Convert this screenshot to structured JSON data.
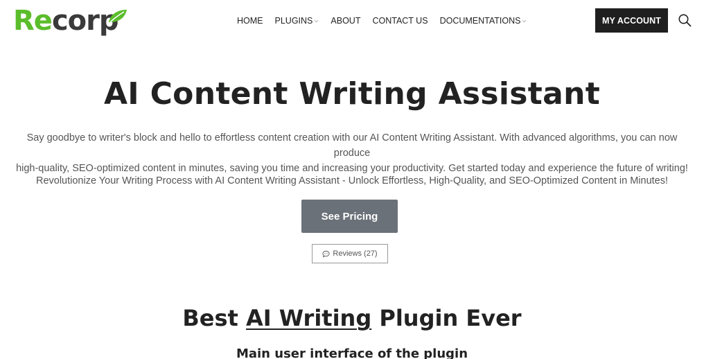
{
  "brand": {
    "logo_part1": "Re",
    "logo_part2": "corp",
    "logo_icon": "leaf-icon",
    "accent_color": "#5bbd2b"
  },
  "nav": {
    "items": [
      {
        "label": "HOME",
        "has_dropdown": false
      },
      {
        "label": "PLUGINS",
        "has_dropdown": true
      },
      {
        "label": "ABOUT",
        "has_dropdown": false
      },
      {
        "label": "CONTACT US",
        "has_dropdown": false
      },
      {
        "label": "DOCUMENTATIONS",
        "has_dropdown": true
      }
    ],
    "account_label": "MY ACCOUNT",
    "search_icon": "search-icon"
  },
  "hero": {
    "title": "AI Content Writing Assistant",
    "description_line1": "Say goodbye to writer's block and hello to effortless content creation with our AI Content Writing Assistant. With advanced algorithms, you can now produce",
    "description_line2": "high-quality, SEO-optimized content in minutes, saving you time and increasing your productivity. Get started today and experience the future of writing!",
    "subtitle": "Revolutionize Your Writing Process with AI Content Writing Assistant - Unlock Effortless, High-Quality, and SEO-Optimized Content in Minutes!",
    "pricing_label": "See Pricing",
    "reviews_label": "Reviews (27)",
    "button_color": "#6b7178"
  },
  "section": {
    "title_before": "Best ",
    "title_link": "AI Writing",
    "title_after": " Plugin Ever",
    "subtitle": "Main user interface of the plugin"
  }
}
